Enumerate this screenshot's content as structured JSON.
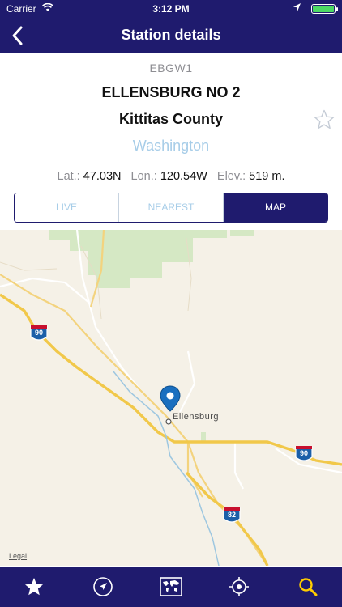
{
  "status_bar": {
    "carrier": "Carrier",
    "time": "3:12 PM"
  },
  "nav": {
    "title": "Station details",
    "back_icon": "chevron-left-icon"
  },
  "station": {
    "code": "EBGW1",
    "name": "ELLENSBURG NO 2",
    "county": "Kittitas County",
    "state": "Washington",
    "lat_label": "Lat.:",
    "lat_value": "47.03N",
    "lon_label": "Lon.:",
    "lon_value": "120.54W",
    "elev_label": "Elev.:",
    "elev_value": "519 m."
  },
  "segments": {
    "live": "LIVE",
    "nearest": "NEAREST",
    "map": "MAP",
    "selected": "MAP"
  },
  "map": {
    "city_label": "Ellensburg",
    "shield_90": "90",
    "shield_82": "82",
    "legal": "Legal"
  },
  "tabbar": {
    "items": [
      "star-icon",
      "navigation-arrow-icon",
      "world-map-icon",
      "locate-target-icon",
      "search-icon"
    ],
    "active_color": "#ffcc00"
  },
  "colors": {
    "brand": "#1f1b6e",
    "accent_light": "#a7cde8",
    "pin": "#1a6fbf"
  }
}
